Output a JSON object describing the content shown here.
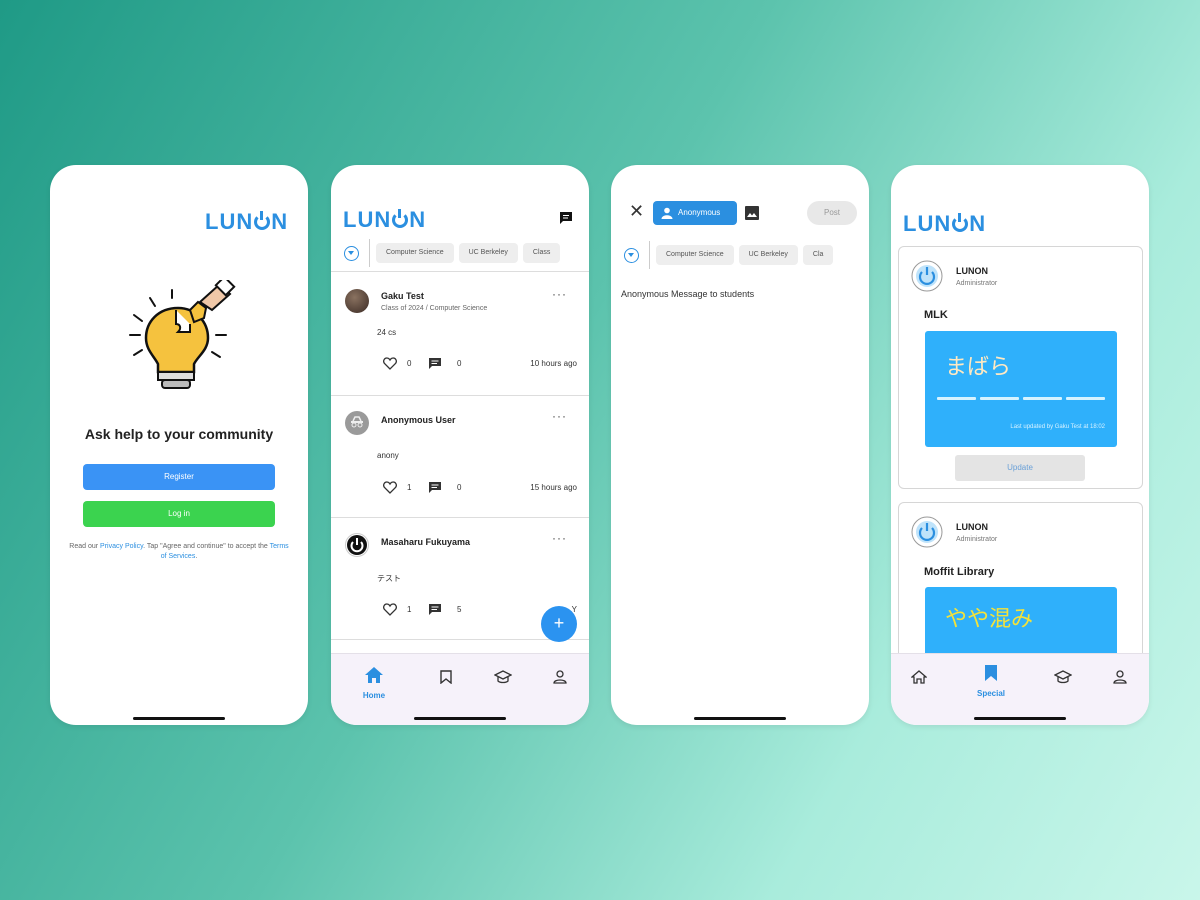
{
  "brand": {
    "logo_prefix": "LUN",
    "logo_suffix": "N"
  },
  "colors": {
    "brand_blue": "#2b8fe0",
    "register_blue": "#3a93f5",
    "login_green": "#3bd34f",
    "panel_blue": "#2fb0fb"
  },
  "screen1": {
    "headline": "Ask help to your community",
    "register_label": "Register",
    "login_label": "Log in",
    "legal": {
      "part1": "Read our ",
      "privacy_link": "Privacy Policy",
      "part2": ". Tap \"Agree and continue\" to accept the ",
      "terms_link": "Terms of Services",
      "part3": "."
    }
  },
  "screen2": {
    "chat_icon": "message-icon",
    "filter_icon": "filter-icon",
    "chips": [
      "Computer Science",
      "UC Berkeley",
      "Class"
    ],
    "posts": [
      {
        "name": "Gaku Test",
        "subtitle": "Class of 2024 / Computer Science",
        "body": "24 cs",
        "likes": "0",
        "comments": "0",
        "time": "10 hours ago",
        "avatar": "photo-avatar"
      },
      {
        "name": "Anonymous User",
        "subtitle": "",
        "body": "anony",
        "likes": "1",
        "comments": "0",
        "time": "15 hours ago",
        "avatar": "anonymous-avatar"
      },
      {
        "name": "Masaharu Fukuyama",
        "subtitle": "",
        "body": "テスト",
        "likes": "1",
        "comments": "5",
        "time": "Y",
        "avatar": "power-avatar"
      }
    ],
    "more_label": "···",
    "fab_label": "+",
    "nav": {
      "home_label": "Home",
      "active": "Home"
    }
  },
  "screen3": {
    "anonymous_label": "Anonymous",
    "post_label": "Post",
    "chips": [
      "Computer Science",
      "UC Berkeley",
      "Cla"
    ],
    "message": "Anonymous Message to  students"
  },
  "screen4": {
    "cards": [
      {
        "name": "LUNON",
        "role": "Administrator",
        "place": "MLK",
        "status": "まばら",
        "updated": "Last updated by Gaku Test at 18:02",
        "update_label": "Update"
      },
      {
        "name": "LUNON",
        "role": "Administrator",
        "place": "Moffit Library",
        "status": "やや混み"
      }
    ],
    "nav": {
      "special_label": "Special",
      "active": "Special"
    }
  }
}
